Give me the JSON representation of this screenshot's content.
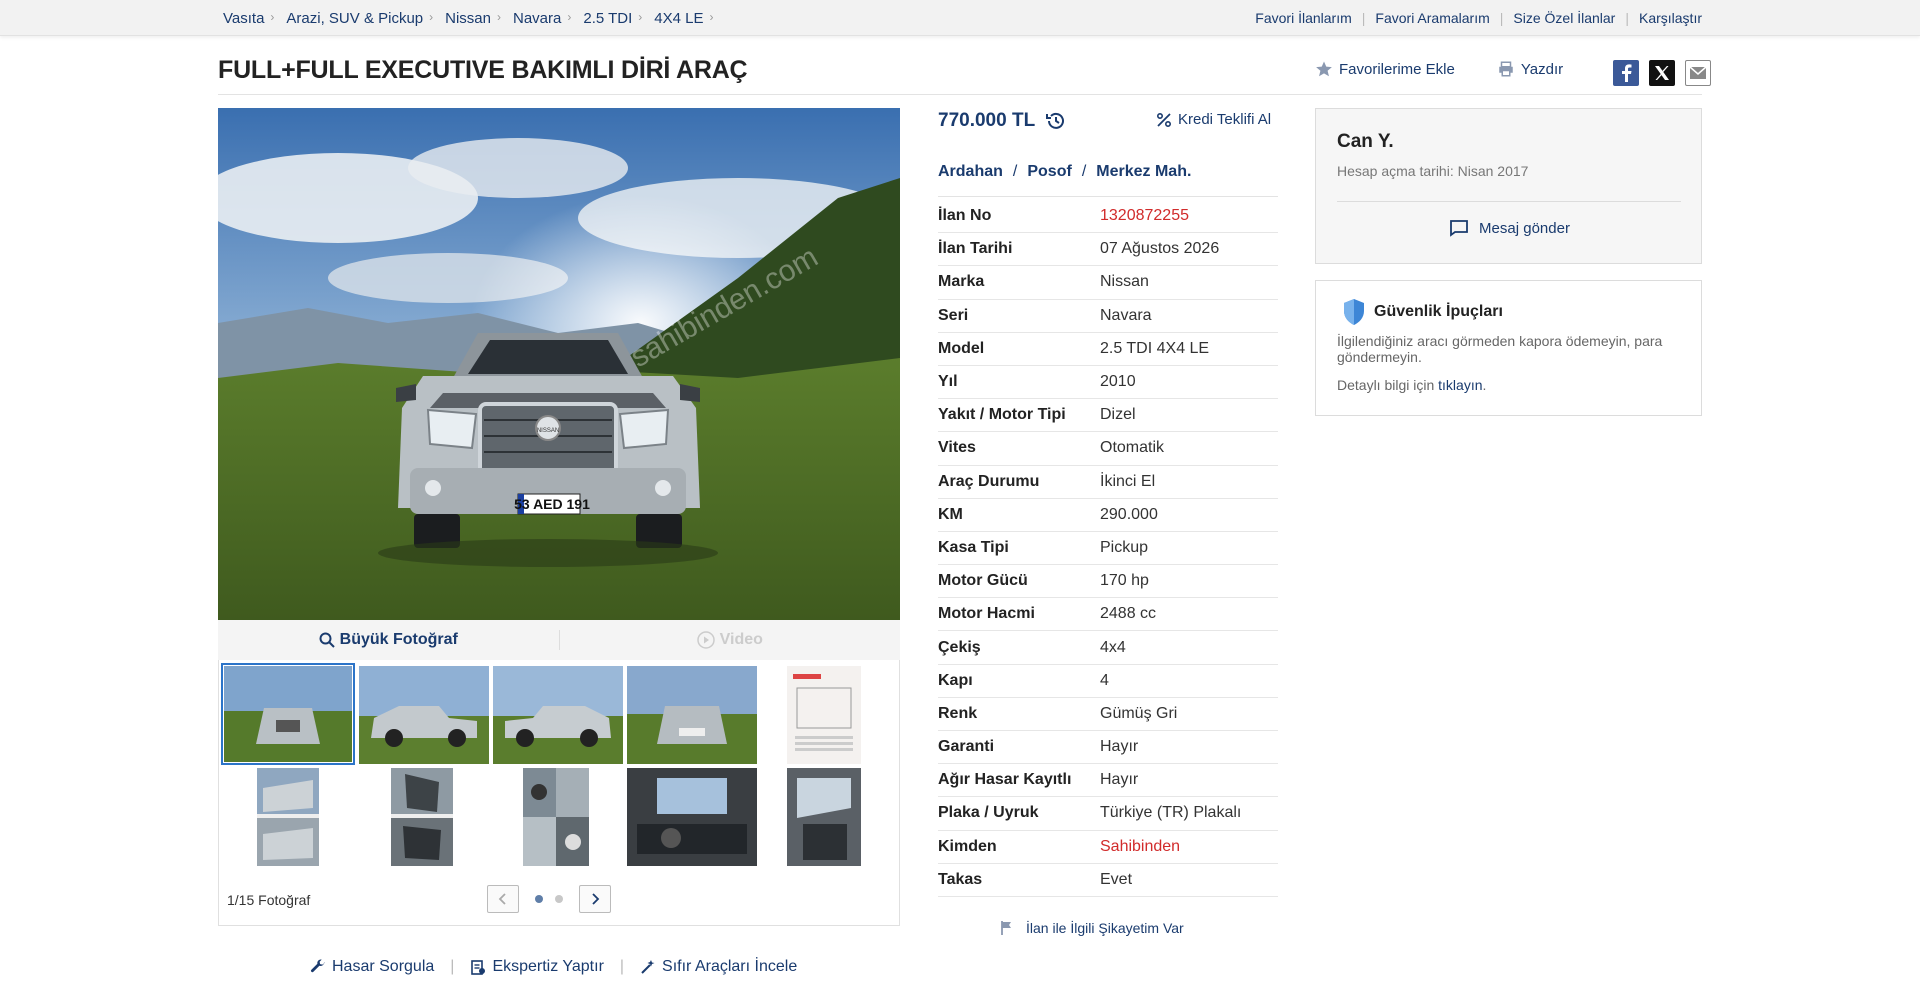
{
  "breadcrumb": [
    "Vasıta",
    "Arazi, SUV & Pickup",
    "Nissan",
    "Navara",
    "2.5 TDI",
    "4X4 LE"
  ],
  "top_links": [
    "Favori İlanlarım",
    "Favori Aramalarım",
    "Size Özel İlanlar",
    "Karşılaştır"
  ],
  "title": "FULL+FULL EXECUTIVE BAKIMLI DİRİ ARAÇ",
  "actions": {
    "favorite": "Favorilerime Ekle",
    "print": "Yazdır"
  },
  "gallery": {
    "large_photo": "Büyük Fotoğraf",
    "video": "Video",
    "counter": "1/15 Fotoğraf",
    "plate": "53 AED 191",
    "watermark": "sahibinden.com",
    "brand": "NISSAN"
  },
  "price": {
    "value": "770.000 TL",
    "loan": "Kredi Teklifi Al"
  },
  "location": [
    "Ardahan",
    "Posof",
    "Merkez Mah."
  ],
  "specs": [
    {
      "label": "İlan No",
      "value": "1320872255",
      "highlight": true
    },
    {
      "label": "İlan Tarihi",
      "value": "07 Ağustos 2026"
    },
    {
      "label": "Marka",
      "value": "Nissan"
    },
    {
      "label": "Seri",
      "value": "Navara"
    },
    {
      "label": "Model",
      "value": "2.5 TDI 4X4 LE"
    },
    {
      "label": "Yıl",
      "value": "2010"
    },
    {
      "label": "Yakıt / Motor Tipi",
      "value": "Dizel"
    },
    {
      "label": "Vites",
      "value": "Otomatik"
    },
    {
      "label": "Araç Durumu",
      "value": "İkinci El"
    },
    {
      "label": "KM",
      "value": "290.000"
    },
    {
      "label": "Kasa Tipi",
      "value": "Pickup"
    },
    {
      "label": "Motor Gücü",
      "value": "170 hp"
    },
    {
      "label": "Motor Hacmi",
      "value": "2488 cc"
    },
    {
      "label": "Çekiş",
      "value": "4x4"
    },
    {
      "label": "Kapı",
      "value": "4"
    },
    {
      "label": "Renk",
      "value": "Gümüş Gri"
    },
    {
      "label": "Garanti",
      "value": "Hayır"
    },
    {
      "label": "Ağır Hasar Kayıtlı",
      "value": "Hayır"
    },
    {
      "label": "Plaka / Uyruk",
      "value": "Türkiye (TR) Plakalı"
    },
    {
      "label": "Kimden",
      "value": "Sahibinden",
      "highlight": true
    },
    {
      "label": "Takas",
      "value": "Evet"
    }
  ],
  "complaint": "İlan ile İlgili Şikayetim Var",
  "bottom_links": [
    "Hasar Sorgula",
    "Ekspertiz Yaptır",
    "Sıfır Araçları İncele"
  ],
  "seller": {
    "name": "Can Y.",
    "since": "Hesap açma tarihi: Nisan 2017",
    "message": "Mesaj gönder"
  },
  "safety": {
    "title": "Güvenlik İpuçları",
    "text": "İlgilendiğiniz aracı görmeden kapora ödemeyin, para göndermeyin.",
    "more_prefix": "Detaylı bilgi için",
    "more_link": "tıklayın",
    "more_suffix": "."
  },
  "colors": {
    "link": "#1a3b6e",
    "red": "#d12b2b",
    "active_border": "#2c74c8"
  }
}
